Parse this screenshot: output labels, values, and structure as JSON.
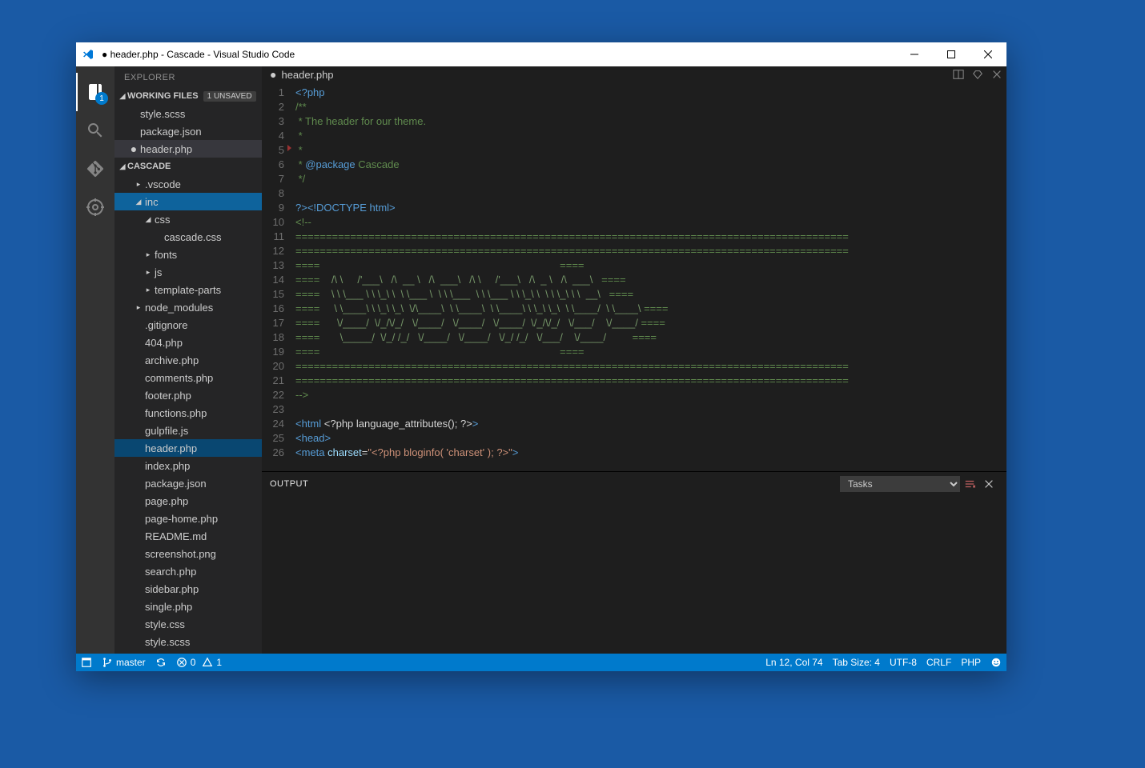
{
  "window": {
    "title": "● header.php - Cascade - Visual Studio Code"
  },
  "activity": {
    "badge_explorer": "1"
  },
  "sidebar": {
    "title": "EXPLORER",
    "working_files_label": "WORKING FILES",
    "unsaved_badge": "1 UNSAVED",
    "working_files": [
      {
        "name": "style.scss",
        "dirty": false
      },
      {
        "name": "package.json",
        "dirty": false
      },
      {
        "name": "header.php",
        "dirty": true
      }
    ],
    "project_label": "CASCADE",
    "tree": [
      {
        "name": ".vscode",
        "type": "folder",
        "indent": 1,
        "expanded": false
      },
      {
        "name": "inc",
        "type": "folder",
        "indent": 1,
        "expanded": true,
        "selected": true
      },
      {
        "name": "css",
        "type": "folder",
        "indent": 2,
        "expanded": true
      },
      {
        "name": "cascade.css",
        "type": "file",
        "indent": 3
      },
      {
        "name": "fonts",
        "type": "folder",
        "indent": 2,
        "expanded": false
      },
      {
        "name": "js",
        "type": "folder",
        "indent": 2,
        "expanded": false
      },
      {
        "name": "template-parts",
        "type": "folder",
        "indent": 2,
        "expanded": false
      },
      {
        "name": "node_modules",
        "type": "folder",
        "indent": 1,
        "expanded": false
      },
      {
        "name": ".gitignore",
        "type": "file",
        "indent": 1
      },
      {
        "name": "404.php",
        "type": "file",
        "indent": 1
      },
      {
        "name": "archive.php",
        "type": "file",
        "indent": 1
      },
      {
        "name": "comments.php",
        "type": "file",
        "indent": 1
      },
      {
        "name": "footer.php",
        "type": "file",
        "indent": 1
      },
      {
        "name": "functions.php",
        "type": "file",
        "indent": 1
      },
      {
        "name": "gulpfile.js",
        "type": "file",
        "indent": 1
      },
      {
        "name": "header.php",
        "type": "file",
        "indent": 1,
        "active": true
      },
      {
        "name": "index.php",
        "type": "file",
        "indent": 1
      },
      {
        "name": "package.json",
        "type": "file",
        "indent": 1
      },
      {
        "name": "page.php",
        "type": "file",
        "indent": 1
      },
      {
        "name": "page-home.php",
        "type": "file",
        "indent": 1
      },
      {
        "name": "README.md",
        "type": "file",
        "indent": 1
      },
      {
        "name": "screenshot.png",
        "type": "file",
        "indent": 1
      },
      {
        "name": "search.php",
        "type": "file",
        "indent": 1
      },
      {
        "name": "sidebar.php",
        "type": "file",
        "indent": 1
      },
      {
        "name": "single.php",
        "type": "file",
        "indent": 1
      },
      {
        "name": "style.css",
        "type": "file",
        "indent": 1
      },
      {
        "name": "style.scss",
        "type": "file",
        "indent": 1
      }
    ]
  },
  "editor": {
    "tab_name": "header.php",
    "lines": [
      [
        {
          "c": "tok-tag",
          "t": "<?php"
        }
      ],
      [
        {
          "c": "tok-comment",
          "t": "/**"
        }
      ],
      [
        {
          "c": "tok-comment",
          "t": " * The header for our theme."
        }
      ],
      [
        {
          "c": "tok-comment",
          "t": " *"
        }
      ],
      [
        {
          "c": "tok-comment",
          "t": " *"
        }
      ],
      [
        {
          "c": "tok-comment",
          "t": " * "
        },
        {
          "c": "tok-doctag",
          "t": "@package"
        },
        {
          "c": "",
          "t": " "
        },
        {
          "c": "tok-comment",
          "t": "Cascade"
        }
      ],
      [
        {
          "c": "tok-comment",
          "t": " */"
        }
      ],
      [],
      [
        {
          "c": "tok-tag",
          "t": "?>"
        },
        {
          "c": "tok-tag",
          "t": "<!DOCTYPE html>"
        }
      ],
      [
        {
          "c": "tok-comment",
          "t": "<!--"
        }
      ],
      [
        {
          "c": "tok-art",
          "t": "==========================================================================================="
        }
      ],
      [
        {
          "c": "tok-art",
          "t": "==========================================================================================="
        }
      ],
      [
        {
          "c": "tok-art",
          "t": "===="
        },
        {
          "c": "tok-dim",
          "t": "                                                                                   "
        },
        {
          "c": "tok-art",
          "t": "===="
        }
      ],
      [
        {
          "c": "tok-art",
          "t": "===="
        },
        {
          "c": "tok-dim",
          "t": "    /\\ \\     /'___\\   /\\  __ \\   /\\  ___\\   /\\ \\     /'___\\   /\\  _ \\   /\\  ___\\   "
        },
        {
          "c": "tok-art",
          "t": "===="
        }
      ],
      [
        {
          "c": "tok-art",
          "t": "===="
        },
        {
          "c": "tok-dim",
          "t": "    \\ \\ \\___ \\ \\ \\_\\ \\  \\ \\___ \\  \\ \\ \\___  \\ \\ \\___ \\ \\ \\_\\ \\  \\ \\ \\_\\ \\ \\  __\\   "
        },
        {
          "c": "tok-art",
          "t": "===="
        }
      ],
      [
        {
          "c": "tok-art",
          "t": "===="
        },
        {
          "c": "tok-dim",
          "t": "     \\ \\____\\ \\ \\_\\ \\_\\  \\/\\____\\  \\ \\____\\  \\ \\____\\ \\ \\_\\ \\_\\  \\ \\____/  \\ \\____\\ "
        },
        {
          "c": "tok-art",
          "t": "===="
        }
      ],
      [
        {
          "c": "tok-art",
          "t": "===="
        },
        {
          "c": "tok-dim",
          "t": "      \\/____/  \\/_/\\/_/   \\/____/   \\/____/   \\/____/  \\/_/\\/_/   \\/___/    \\/____/ "
        },
        {
          "c": "tok-art",
          "t": "===="
        }
      ],
      [
        {
          "c": "tok-art",
          "t": "===="
        },
        {
          "c": "tok-dim",
          "t": "       \\_____/  \\/_/ /_/   \\/____/   \\/____/   \\/_/ /_/   \\/___/    \\/____/         "
        },
        {
          "c": "tok-art",
          "t": "===="
        }
      ],
      [
        {
          "c": "tok-art",
          "t": "===="
        },
        {
          "c": "tok-dim",
          "t": "                                                                                   "
        },
        {
          "c": "tok-art",
          "t": "===="
        }
      ],
      [
        {
          "c": "tok-art",
          "t": "==========================================================================================="
        }
      ],
      [
        {
          "c": "tok-art",
          "t": "==========================================================================================="
        }
      ],
      [
        {
          "c": "tok-comment",
          "t": "-->"
        }
      ],
      [],
      [
        {
          "c": "tok-tag",
          "t": "<html "
        },
        {
          "c": "",
          "t": "<?php language_attributes(); ?>"
        },
        {
          "c": "tok-tag",
          "t": ">"
        }
      ],
      [
        {
          "c": "tok-tag",
          "t": "<head>"
        }
      ],
      [
        {
          "c": "tok-tag",
          "t": "<meta "
        },
        {
          "c": "tok-attr",
          "t": "charset"
        },
        {
          "c": "",
          "t": "="
        },
        {
          "c": "tok-str",
          "t": "\"<?php bloginfo( 'charset' ); ?>\""
        },
        {
          "c": "tok-tag",
          "t": ">"
        }
      ]
    ]
  },
  "panel": {
    "label": "OUTPUT",
    "select": "Tasks"
  },
  "status": {
    "branch": "master",
    "errors": "0",
    "warnings": "1",
    "position": "Ln 12, Col 74",
    "tabsize": "Tab Size: 4",
    "encoding": "UTF-8",
    "eol": "CRLF",
    "language": "PHP"
  }
}
